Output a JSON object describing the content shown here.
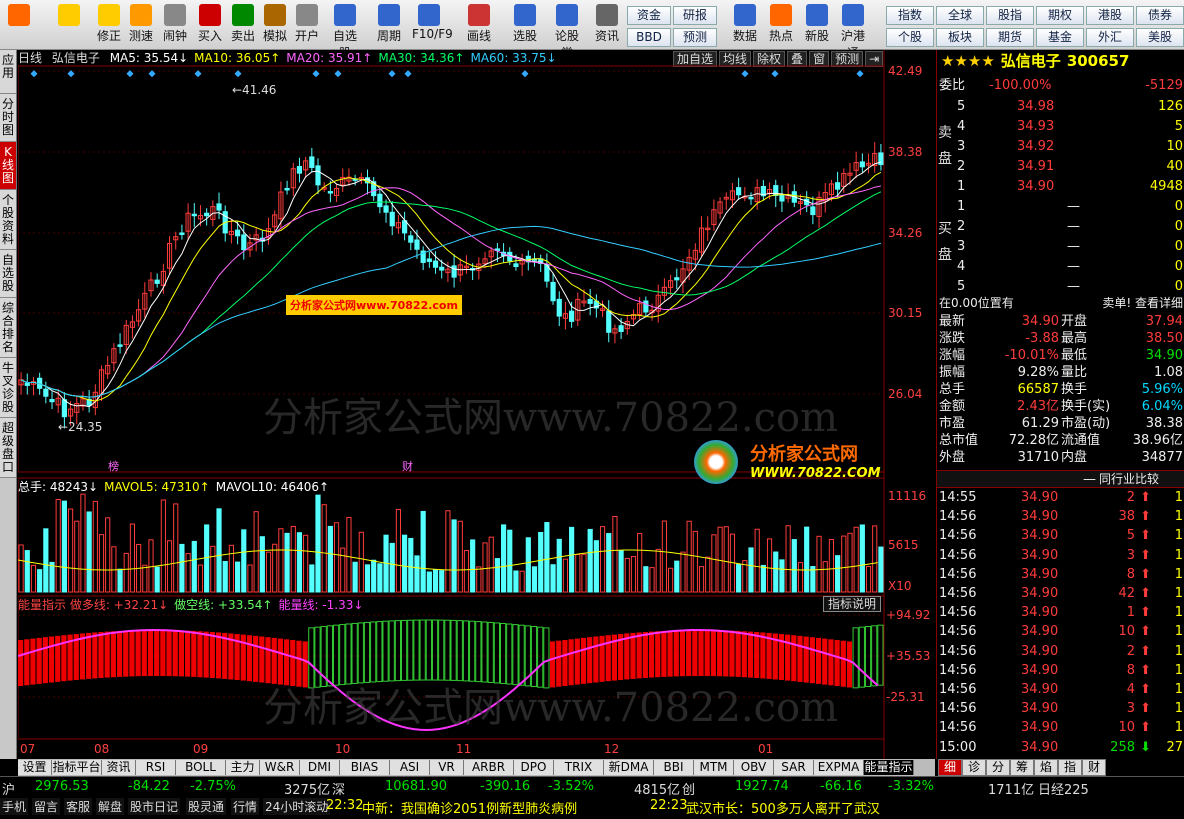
{
  "toolbar": {
    "items": [
      {
        "label": "",
        "icon": "windows-grid-icon"
      },
      {
        "label": "",
        "icon": "back-arrow-icon"
      },
      {
        "label": "修正",
        "icon": "updown-icon"
      },
      {
        "label": "测速",
        "icon": "speed-icon"
      },
      {
        "label": "闹钟",
        "icon": "clock-icon"
      },
      {
        "label": "买入",
        "icon": "buy-icon"
      },
      {
        "label": "卖出",
        "icon": "sell-icon"
      },
      {
        "label": "模拟",
        "icon": "gavel-icon"
      },
      {
        "label": "开户",
        "icon": "lock-icon"
      },
      {
        "label": "自选股",
        "icon": "star-folder-icon"
      },
      {
        "label": "周期",
        "icon": "cycle-icon"
      },
      {
        "label": "F10/F9",
        "icon": "f10-icon"
      },
      {
        "label": "画线",
        "icon": "pen-icon"
      },
      {
        "label": "选股",
        "icon": "select-icon"
      },
      {
        "label": "论股堂",
        "icon": "forum-icon"
      },
      {
        "label": "资讯",
        "icon": "doc-icon"
      }
    ],
    "mid_buttons": [
      [
        "资金",
        "研报"
      ],
      [
        "BBD",
        "预测"
      ]
    ],
    "more": [
      {
        "label": "数据",
        "icon": "pe-icon"
      },
      {
        "label": "热点",
        "icon": "fire-icon"
      },
      {
        "label": "新股",
        "icon": "ipo-icon"
      },
      {
        "label": "沪港通",
        "icon": "hk-icon"
      }
    ],
    "right_buttons": [
      [
        "指数",
        "全球",
        "股指",
        "期权",
        "港股",
        "债券"
      ],
      [
        "个股",
        "板块",
        "期货",
        "基金",
        "外汇",
        "美股"
      ]
    ]
  },
  "left_tabs": [
    "应用",
    "分时图",
    "K线图",
    "个股资料",
    "自选股",
    "综合排名",
    "牛叉诊股",
    "超级盘口"
  ],
  "chart": {
    "period": "日线",
    "name": "弘信电子",
    "ma": [
      {
        "label": "MA5: 35.54",
        "arrow": "↓",
        "color": "#ffffff"
      },
      {
        "label": "MA10: 36.05",
        "arrow": "↑",
        "color": "#ffff00"
      },
      {
        "label": "MA20: 35.91",
        "arrow": "↑",
        "color": "#ff66ff"
      },
      {
        "label": "MA30: 34.36",
        "arrow": "↑",
        "color": "#00ff66"
      },
      {
        "label": "MA60: 33.75",
        "arrow": "↓",
        "color": "#33ccff"
      }
    ],
    "tools": [
      "加自选",
      "均线",
      "除权",
      "叠",
      "窗",
      "预测",
      "⇥"
    ],
    "y_ticks": [
      "42.49",
      "38.38",
      "34.26",
      "30.15",
      "26.04"
    ],
    "high_label": "41.46",
    "low_label": "24.35",
    "marker_bang": "榜",
    "marker_cai": "财",
    "watermark": "分析家公式网www.70822.com",
    "small_wm": "分析家公式网www.70822.com",
    "logo_text": "分析家公式网",
    "logo_url": "WWW.70822.COM",
    "vol_header": [
      {
        "label": "总手: 48243",
        "arrow": "↓",
        "color": "#ffffff"
      },
      {
        "label": "MAVOL5: 47310",
        "arrow": "↑",
        "color": "#ffff00"
      },
      {
        "label": "MAVOL10: 46406",
        "arrow": "↑",
        "color": "#ffffff"
      }
    ],
    "vol_ticks": [
      "11116",
      "5615",
      "X10"
    ],
    "ind_header": [
      {
        "label": "能量指示 做多线: +32.21",
        "arrow": "↓",
        "color": "#ff4444"
      },
      {
        "label": "做空线: +33.54",
        "arrow": "↑",
        "color": "#66ff66"
      },
      {
        "label": "能量线: -1.33",
        "arrow": "↓",
        "color": "#ff44ff"
      }
    ],
    "ind_btn": "指标说明",
    "ind_ticks": [
      "+94.92",
      "+35.53",
      "-25.31"
    ],
    "months": [
      "07",
      "08",
      "09",
      "10",
      "11",
      "12",
      "01"
    ]
  },
  "tabs": [
    "设置",
    "指标平台",
    "资讯",
    "RSI",
    "BOLL",
    "主力",
    "W&R",
    "DMI",
    "BIAS",
    "ASI",
    "VR",
    "ARBR",
    "DPO",
    "TRIX",
    "新DMA",
    "BBI",
    "MTM",
    "OBV",
    "SAR",
    "EXPMA",
    "能量指示"
  ],
  "stock": {
    "stars": "★★★★",
    "name": "弘信电子",
    "code": "300657",
    "weibi": {
      "label": "委比",
      "pct": "-100.00%",
      "val": "-5129"
    },
    "sell_label": "卖盘",
    "buy_label": "买盘",
    "sell": [
      [
        "5",
        "34.98",
        "126"
      ],
      [
        "4",
        "34.93",
        "5"
      ],
      [
        "3",
        "34.92",
        "10"
      ],
      [
        "2",
        "34.91",
        "40"
      ],
      [
        "1",
        "34.90",
        "4948"
      ]
    ],
    "buy": [
      [
        "1",
        "—",
        "0"
      ],
      [
        "2",
        "—",
        "0"
      ],
      [
        "3",
        "—",
        "0"
      ],
      [
        "4",
        "—",
        "0"
      ],
      [
        "5",
        "—",
        "0"
      ]
    ],
    "pos": "在0.00位置有",
    "pos_right": "卖单! 查看详细",
    "stats": [
      [
        "最新",
        "34.90",
        "开盘",
        "37.94"
      ],
      [
        "涨跌",
        "-3.88",
        "最高",
        "38.50"
      ],
      [
        "涨幅",
        "-10.01%",
        "最低",
        "34.90"
      ],
      [
        "振幅",
        "9.28%",
        "量比",
        "1.08"
      ],
      [
        "总手",
        "66587",
        "换手",
        "5.96%"
      ],
      [
        "金额",
        "2.43亿",
        "换手(实)",
        "6.04%"
      ],
      [
        "市盈",
        "61.29",
        "市盈(动)",
        "38.38"
      ],
      [
        "总市值",
        "72.28亿",
        "流通值",
        "38.96亿"
      ],
      [
        "外盘",
        "31710",
        "内盘",
        "34877"
      ]
    ],
    "compare": "同行业比较",
    "ticks": [
      [
        "14:55",
        "34.90",
        "2"
      ],
      [
        "14:56",
        "34.90",
        "38"
      ],
      [
        "14:56",
        "34.90",
        "5"
      ],
      [
        "14:56",
        "34.90",
        "3"
      ],
      [
        "14:56",
        "34.90",
        "8"
      ],
      [
        "14:56",
        "34.90",
        "42"
      ],
      [
        "14:56",
        "34.90",
        "1"
      ],
      [
        "14:56",
        "34.90",
        "10"
      ],
      [
        "14:56",
        "34.90",
        "2"
      ],
      [
        "14:56",
        "34.90",
        "8"
      ],
      [
        "14:56",
        "34.90",
        "4"
      ],
      [
        "14:56",
        "34.90",
        "3"
      ],
      [
        "14:56",
        "34.90",
        "10"
      ],
      [
        "15:00",
        "34.90",
        "258"
      ]
    ],
    "tick_tail": [
      "1",
      "1",
      "1",
      "1",
      "1",
      "1",
      "1",
      "1",
      "1",
      "1",
      "1",
      "1",
      "1",
      "27"
    ],
    "right_tabs": [
      "细",
      "诊",
      "分",
      "筹",
      "焰",
      "指",
      "财"
    ]
  },
  "status": {
    "sh_label": "沪",
    "sh": "2976.53",
    "sh_chg": "-84.22",
    "sh_pct": "-2.75%",
    "sh_amt": "3275亿",
    "sz_label": "深",
    "sz": "10681.90",
    "sz_chg": "-390.16",
    "sz_pct": "-3.52%",
    "sz_amt": "4815亿",
    "cy_label": "创",
    "cy": "1927.74",
    "cy_chg": "-66.16",
    "cy_pct": "-3.32%",
    "cy_amt": "1711亿",
    "nk": "日经225",
    "links": [
      "手机",
      "留言",
      "客服",
      "解盘",
      "股市日记",
      "股灵通",
      "行情",
      "24小时滚动"
    ],
    "news1_time": "22:32",
    "news1": "中新：我国确诊2051例新型肺炎病例",
    "news2_time": "22:23",
    "news2": "武汉市长：500多万人离开了武汉"
  }
}
